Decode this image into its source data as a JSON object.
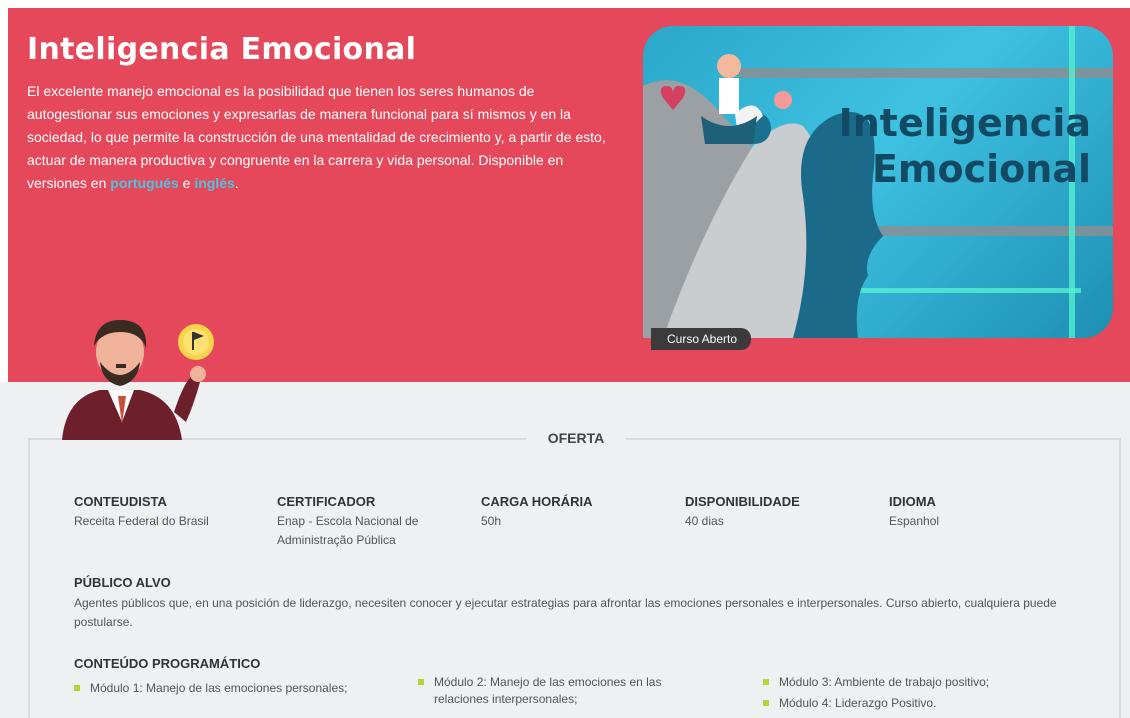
{
  "hero": {
    "title": "Inteligencia Emocional",
    "description": "El excelente manejo emocional es la posibilidad que tienen los seres humanos de autogestionar sus emociones y expresarlas de manera funcional para sí mismos y en la sociedad, lo que permite la construcción de una mentalidad de crecimiento y, a partir de esto, actuar de manera productiva y congruente en la carrera y vida personal.",
    "versions_prefix": "Disponible en versiones en",
    "link_pt": "portugués",
    "versions_and": "e",
    "link_en": "inglés",
    "versions_suffix": ".",
    "cover_title_line1": "Inteligencia",
    "cover_title_line2": "Emocional",
    "badge": "Curso Aberto",
    "bg_color": "#e5485a"
  },
  "offer": {
    "title": "OFERTA",
    "info": [
      {
        "label": "CONTEUDISTA",
        "value": "Receita Federal do Brasil"
      },
      {
        "label": "CERTIFICADOR",
        "value": "Enap - Escola Nacional de Administração Pública"
      },
      {
        "label": "CARGA HORÁRIA",
        "value": "50h"
      },
      {
        "label": "DISPONIBILIDADE",
        "value": "40 dias"
      },
      {
        "label": "IDIOMA",
        "value": "Espanhol"
      }
    ],
    "audience_label": "PÚBLICO ALVO",
    "audience_text": "Agentes públicos que, en una posición de liderazgo, necesiten conocer y ejecutar estrategias para afrontar las emociones personales e interpersonales. Curso abierto, cualquiera puede postularse.",
    "program_label": "CONTEÚDO PROGRAMÁTICO",
    "modules": [
      "Módulo 1: Manejo de las emociones personales;",
      "Módulo 2: Manejo de las emociones en las relaciones interpersonales;",
      "Módulo 3: Ambiente de trabajo positivo;",
      "Módulo 4: Liderazgo Positivo."
    ],
    "bullet_color": "#b8d23a"
  }
}
